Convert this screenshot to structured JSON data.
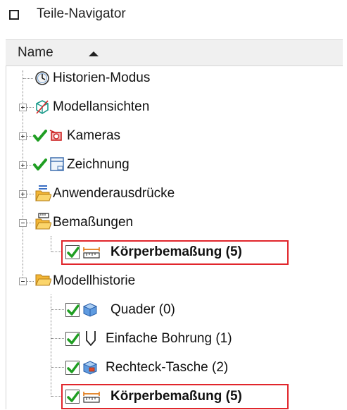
{
  "window": {
    "title": "Teile-Navigator"
  },
  "header": {
    "column_name": "Name",
    "sort_direction": "ascending"
  },
  "tree": {
    "history_mode": "Historien-Modus",
    "model_views": "Modellansichten",
    "cameras": "Kameras",
    "drawing": "Zeichnung",
    "user_expressions": "Anwenderausdrücke",
    "dimensions": "Bemaßungen",
    "dimensions_child": "Körperbemaßung (5)",
    "model_history": "Modellhistorie",
    "history_items": [
      "Quader (0)",
      "Einfache Bohrung (1)",
      "Rechteck-Tasche (2)",
      "Körperbemaßung (5)"
    ]
  },
  "colors": {
    "highlight": "#e1262c",
    "check": "#1f9e22",
    "folder": "#f3b636"
  }
}
